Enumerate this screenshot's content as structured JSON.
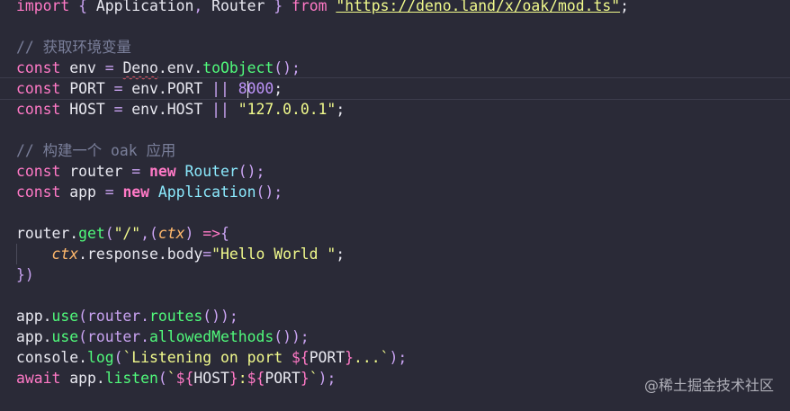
{
  "code_lines": [
    {
      "segments": [
        {
          "t": "import",
          "c": "kw"
        },
        {
          "t": " { ",
          "c": "op"
        },
        {
          "t": "Application",
          "c": "var"
        },
        {
          "t": ", ",
          "c": "op"
        },
        {
          "t": "Router",
          "c": "var"
        },
        {
          "t": " } ",
          "c": "op"
        },
        {
          "t": "from",
          "c": "kw"
        },
        {
          "t": " ",
          "c": "var"
        },
        {
          "t": "\"https://deno.land/x/oak/mod.ts\"",
          "c": "url"
        },
        {
          "t": ";",
          "c": "var"
        }
      ]
    },
    {
      "segments": []
    },
    {
      "segments": [
        {
          "t": "// 获取环境变量",
          "c": "cmt"
        }
      ]
    },
    {
      "segments": [
        {
          "t": "const",
          "c": "kw"
        },
        {
          "t": " env ",
          "c": "var"
        },
        {
          "t": "=",
          "c": "op"
        },
        {
          "t": " ",
          "c": "var"
        },
        {
          "t": "Deno",
          "c": "var squig"
        },
        {
          "t": ".env.",
          "c": "var"
        },
        {
          "t": "toObject",
          "c": "fn"
        },
        {
          "t": "();",
          "c": "op"
        }
      ]
    },
    {
      "active": true,
      "segments": [
        {
          "t": "const",
          "c": "kw"
        },
        {
          "t": " PORT ",
          "c": "var"
        },
        {
          "t": "=",
          "c": "op"
        },
        {
          "t": " env.PORT ",
          "c": "var"
        },
        {
          "t": "||",
          "c": "op"
        },
        {
          "t": " ",
          "c": "var"
        },
        {
          "t": "8",
          "c": "num"
        },
        {
          "caret": true
        },
        {
          "t": "000",
          "c": "num"
        },
        {
          "t": ";",
          "c": "var"
        }
      ]
    },
    {
      "segments": [
        {
          "t": "const",
          "c": "kw"
        },
        {
          "t": " HOST ",
          "c": "var"
        },
        {
          "t": "=",
          "c": "op"
        },
        {
          "t": " env.HOST ",
          "c": "var"
        },
        {
          "t": "||",
          "c": "op"
        },
        {
          "t": " ",
          "c": "var"
        },
        {
          "t": "\"127.0.0.1\"",
          "c": "str"
        },
        {
          "t": ";",
          "c": "var"
        }
      ]
    },
    {
      "segments": []
    },
    {
      "segments": [
        {
          "t": "// 构建一个 oak 应用",
          "c": "cmt"
        }
      ]
    },
    {
      "segments": [
        {
          "t": "const",
          "c": "kw"
        },
        {
          "t": " router ",
          "c": "var"
        },
        {
          "t": "=",
          "c": "op"
        },
        {
          "t": " ",
          "c": "var"
        },
        {
          "t": "new",
          "c": "kwb"
        },
        {
          "t": " ",
          "c": "var"
        },
        {
          "t": "Router",
          "c": "cls"
        },
        {
          "t": "();",
          "c": "op"
        }
      ]
    },
    {
      "segments": [
        {
          "t": "const",
          "c": "kw"
        },
        {
          "t": " app ",
          "c": "var"
        },
        {
          "t": "=",
          "c": "op"
        },
        {
          "t": " ",
          "c": "var"
        },
        {
          "t": "new",
          "c": "kwb"
        },
        {
          "t": " ",
          "c": "var"
        },
        {
          "t": "Application",
          "c": "cls"
        },
        {
          "t": "();",
          "c": "op"
        }
      ]
    },
    {
      "segments": []
    },
    {
      "segments": [
        {
          "t": "router.",
          "c": "var"
        },
        {
          "t": "get",
          "c": "fn"
        },
        {
          "t": "(",
          "c": "op"
        },
        {
          "t": "\"/\"",
          "c": "str"
        },
        {
          "t": ",(",
          "c": "op"
        },
        {
          "t": "ctx",
          "c": "param"
        },
        {
          "t": ") ",
          "c": "op"
        },
        {
          "t": "=>",
          "c": "kw"
        },
        {
          "t": "{",
          "c": "op"
        }
      ]
    },
    {
      "guide": true,
      "segments": [
        {
          "t": "    ",
          "c": "var"
        },
        {
          "t": "ctx",
          "c": "param"
        },
        {
          "t": ".response.body",
          "c": "var"
        },
        {
          "t": "=",
          "c": "op"
        },
        {
          "t": "\"Hello World \"",
          "c": "str"
        },
        {
          "t": ";",
          "c": "var"
        }
      ]
    },
    {
      "segments": [
        {
          "t": "})",
          "c": "op"
        }
      ]
    },
    {
      "segments": []
    },
    {
      "segments": [
        {
          "t": "app.",
          "c": "var"
        },
        {
          "t": "use",
          "c": "fn"
        },
        {
          "t": "(router.",
          "c": "op"
        },
        {
          "t": "routes",
          "c": "fn"
        },
        {
          "t": "());",
          "c": "op"
        }
      ]
    },
    {
      "segments": [
        {
          "t": "app.",
          "c": "var"
        },
        {
          "t": "use",
          "c": "fn"
        },
        {
          "t": "(router.",
          "c": "op"
        },
        {
          "t": "allowedMethods",
          "c": "fn"
        },
        {
          "t": "());",
          "c": "op"
        }
      ]
    },
    {
      "segments": [
        {
          "t": "console.",
          "c": "var"
        },
        {
          "t": "log",
          "c": "fn"
        },
        {
          "t": "(",
          "c": "op"
        },
        {
          "t": "`Listening on port ",
          "c": "tmpl"
        },
        {
          "t": "${",
          "c": "interp"
        },
        {
          "t": "PORT",
          "c": "var"
        },
        {
          "t": "}",
          "c": "interp"
        },
        {
          "t": "...`",
          "c": "tmpl"
        },
        {
          "t": ");",
          "c": "op"
        }
      ]
    },
    {
      "segments": [
        {
          "t": "await",
          "c": "kw"
        },
        {
          "t": " app.",
          "c": "var"
        },
        {
          "t": "listen",
          "c": "fn"
        },
        {
          "t": "(",
          "c": "op"
        },
        {
          "t": "`",
          "c": "tmpl"
        },
        {
          "t": "${",
          "c": "interp"
        },
        {
          "t": "HOST",
          "c": "var"
        },
        {
          "t": "}",
          "c": "interp"
        },
        {
          "t": ":",
          "c": "tmpl"
        },
        {
          "t": "${",
          "c": "interp"
        },
        {
          "t": "PORT",
          "c": "var"
        },
        {
          "t": "}",
          "c": "interp"
        },
        {
          "t": "`",
          "c": "tmpl"
        },
        {
          "t": ");",
          "c": "op"
        }
      ]
    }
  ],
  "watermark": "@稀土掘金技术社区",
  "colors": {
    "background": "#2a2a37",
    "keyword": "#ff79c6",
    "string": "#f1fa8c",
    "function": "#50fa7b",
    "class": "#8be9fd",
    "number": "#bd93f9",
    "comment": "#7a7f9a",
    "parameter": "#ffb86c"
  }
}
